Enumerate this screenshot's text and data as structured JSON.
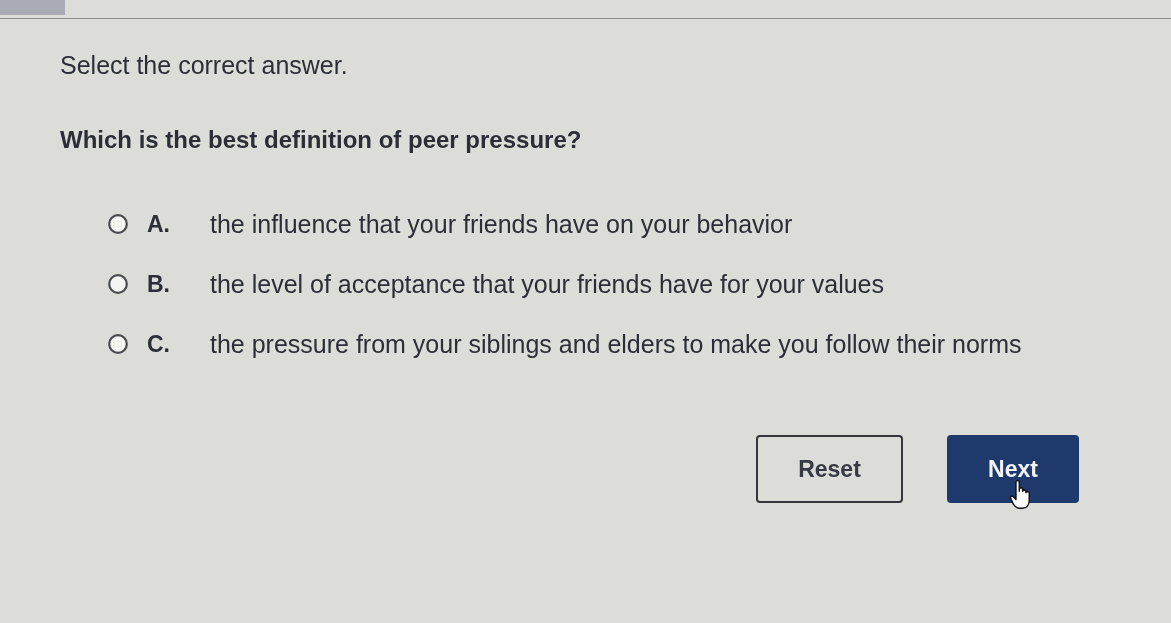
{
  "instruction": "Select the correct answer.",
  "question": "Which is the best definition of peer pressure?",
  "options": [
    {
      "letter": "A.",
      "text": "the influence that your friends have on your behavior",
      "selected": false
    },
    {
      "letter": "B.",
      "text": "the level of acceptance that your friends have for your values",
      "selected": false
    },
    {
      "letter": "C.",
      "text": "the pressure from your siblings and elders to make you follow their norms",
      "selected": false
    }
  ],
  "buttons": [
    {
      "label": "Reset",
      "kind": "outline",
      "hovered": false
    },
    {
      "label": "Next",
      "kind": "primary",
      "hovered": true
    }
  ]
}
